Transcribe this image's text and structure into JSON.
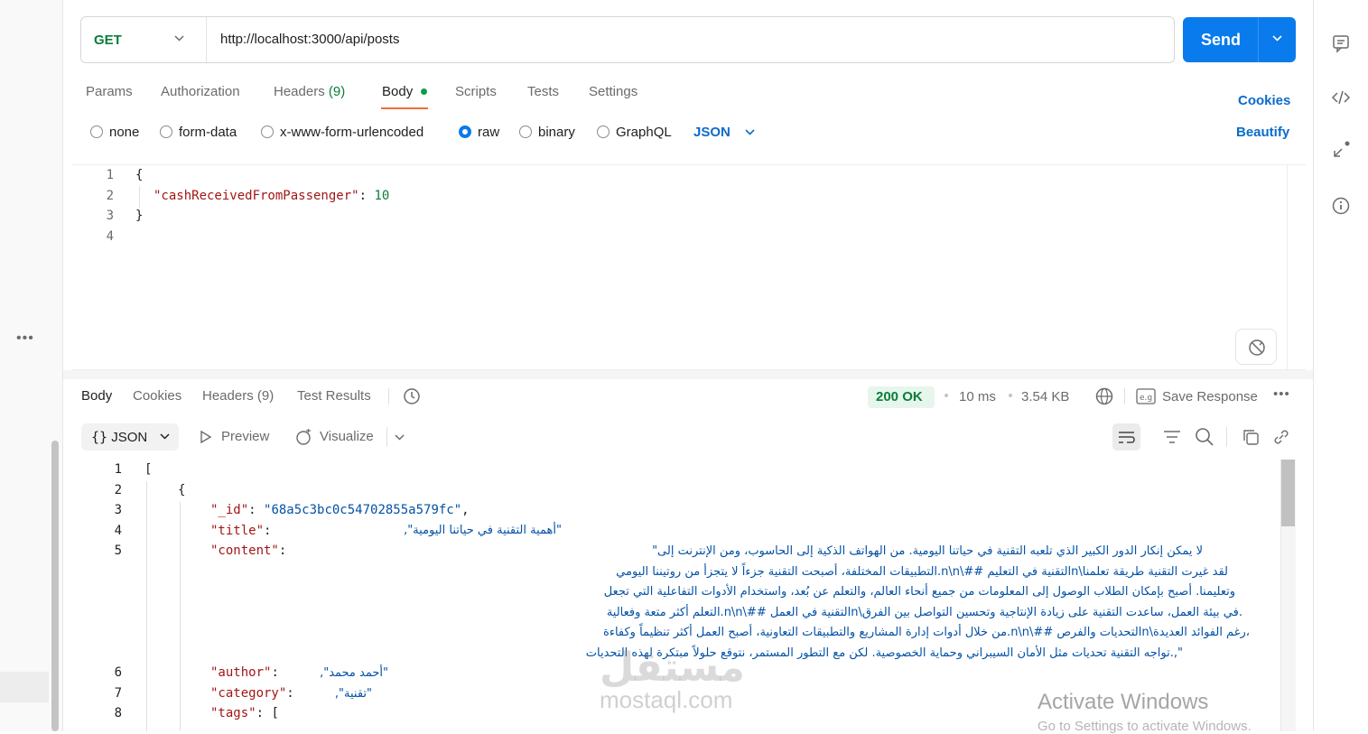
{
  "request": {
    "method": "GET",
    "url": "http://localhost:3000/api/posts",
    "send_label": "Send"
  },
  "request_tabs": {
    "params": "Params",
    "authorization": "Authorization",
    "headers": "Headers",
    "headers_count": "(9)",
    "body": "Body",
    "scripts": "Scripts",
    "tests": "Tests",
    "settings": "Settings",
    "cookies": "Cookies"
  },
  "body_types": {
    "none": "none",
    "form_data": "form-data",
    "urlencoded": "x-www-form-urlencoded",
    "raw": "raw",
    "binary": "binary",
    "graphql": "GraphQL",
    "selected": "raw",
    "language": "JSON",
    "beautify": "Beautify"
  },
  "request_body": {
    "line_numbers": [
      "1",
      "2",
      "3",
      "4"
    ],
    "open_brace": "{",
    "key": "\"cashReceivedFromPassenger\"",
    "colon": ": ",
    "value": "10",
    "close_brace": "}"
  },
  "response_tabs": {
    "body": "Body",
    "cookies": "Cookies",
    "headers": "Headers (9)",
    "test_results": "Test Results"
  },
  "response_meta": {
    "status": "200 OK",
    "time": "10 ms",
    "size": "3.54 KB",
    "save_response": "Save Response"
  },
  "response_toolbar": {
    "format": "JSON",
    "preview": "Preview",
    "visualize": "Visualize"
  },
  "response_body": {
    "line_numbers": [
      "1",
      "2",
      "3",
      "4",
      "5",
      "6",
      "7",
      "8"
    ],
    "l1": "[",
    "l2": "{",
    "id_key": "\"_id\"",
    "id_val": "\"68a5c3bc0c54702855a579fc\"",
    "title_key": "\"title\"",
    "title_val": "\"أهمية التقنية في حياتنا اليومية\",",
    "content_key": "\"content\"",
    "content_lines": [
      "لا يمكن إنكار الدور الكبير الذي تلعبه التقنية في حياتنا اليومية. من الهواتف الذكية إلى الحاسوب، ومن الإنترنت إلى\"",
      "لقد غيرت التقنية طريقة تعلمنا\\nالتقنية في التعليم ##\\n\\n.التطبيقات المختلفة، أصبحت التقنية جزءاً لا يتجزأ من روتيننا اليومي",
      "وتعليمنا. أصبح بإمكان الطلاب الوصول إلى المعلومات من جميع أنحاء العالم، والتعلم عن بُعد، واستخدام الأدوات التفاعلية التي تجعل",
      ".في بيئة العمل، ساعدت التقنية على زيادة الإنتاجية وتحسين التواصل بين الفرق\\nالتقنية في العمل ##\\n\\n.التعلم أكثر متعة وفعالية",
      "،رغم الفوائد العديدة\\nالتحديات والفرص ##\\n\\n.من خلال أدوات إدارة المشاريع والتطبيقات التعاونية، أصبح العمل أكثر تنظيماً وكفاءة",
      "\",.تواجه التقنية تحديات مثل الأمان السيبراني وحماية الخصوصية. لكن مع التطور المستمر، نتوقع حلولاً مبتكرة لهذه التحديات"
    ],
    "author_key": "\"author\"",
    "author_val": "\"أحمد محمد\",",
    "category_key": "\"category\"",
    "category_val": "\"تقنية\",",
    "tags_key": "\"tags\"",
    "tags_val": "["
  },
  "watermarks": {
    "logo": "مستقل",
    "site": "mostaql.com",
    "activate_title": "Activate Windows",
    "activate_sub": "Go to Settings to activate Windows."
  },
  "icons": {
    "left_more": "more-horizontal-icon",
    "comments": "comment-icon",
    "code": "code-icon",
    "related": "related-collections-icon",
    "info": "info-icon",
    "history": "history-icon",
    "globe": "globe-icon",
    "save": "save-example-icon",
    "more": "more-icon",
    "wrap": "wrap-lines-icon",
    "filter": "filter-icon",
    "search": "search-icon",
    "copy": "copy-icon",
    "link": "link-icon"
  },
  "colors": {
    "accent": "#097bed",
    "success": "#0a7d3b",
    "tab_underline": "#f26b3a",
    "json_key": "#a31515",
    "json_string": "#0451a5"
  }
}
